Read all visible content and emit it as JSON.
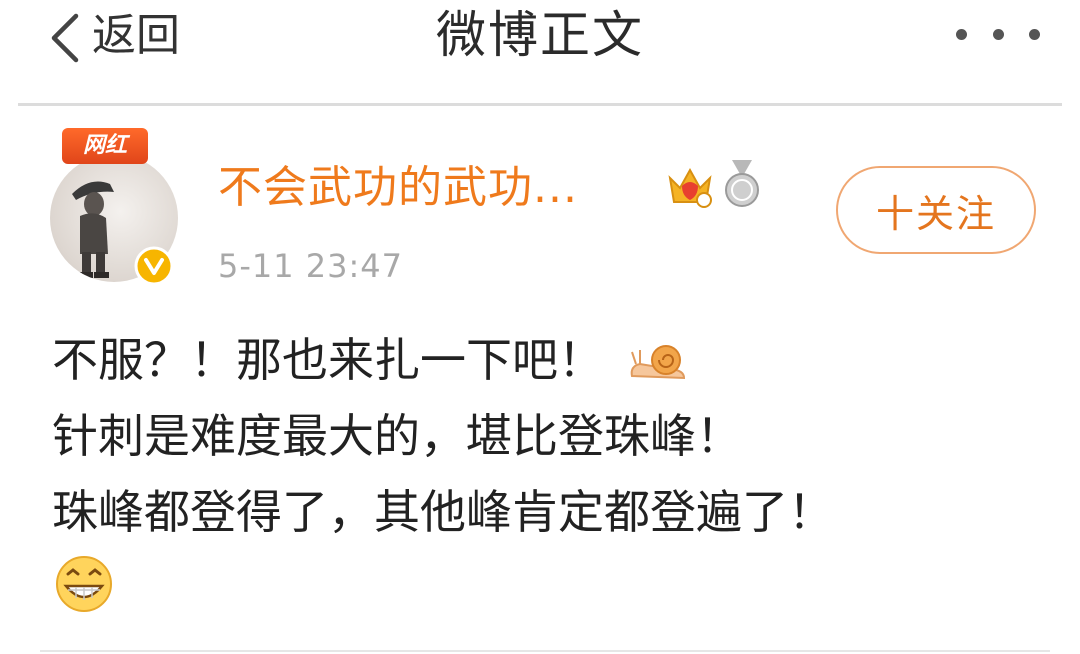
{
  "nav": {
    "back_label": "返回",
    "title": "微博正文",
    "more_icon": "more-dots-icon"
  },
  "author": {
    "badge_label": "网红",
    "name": "不会武功的武功...",
    "post_time": "5-11 23:47",
    "follow_label": "十关注",
    "name_color": "#ef7a1c",
    "icons": [
      "verified-icon",
      "crown-icon",
      "medal-icon"
    ]
  },
  "post": {
    "lines": [
      "不服？！那也来扎一下吧！",
      "针刺是难度最大的，堪比登珠峰！",
      "珠峰都登得了，其他峰肯定都登遍了！"
    ],
    "emojis": [
      "snail-emoji-icon",
      "grin-emoji-icon"
    ]
  }
}
